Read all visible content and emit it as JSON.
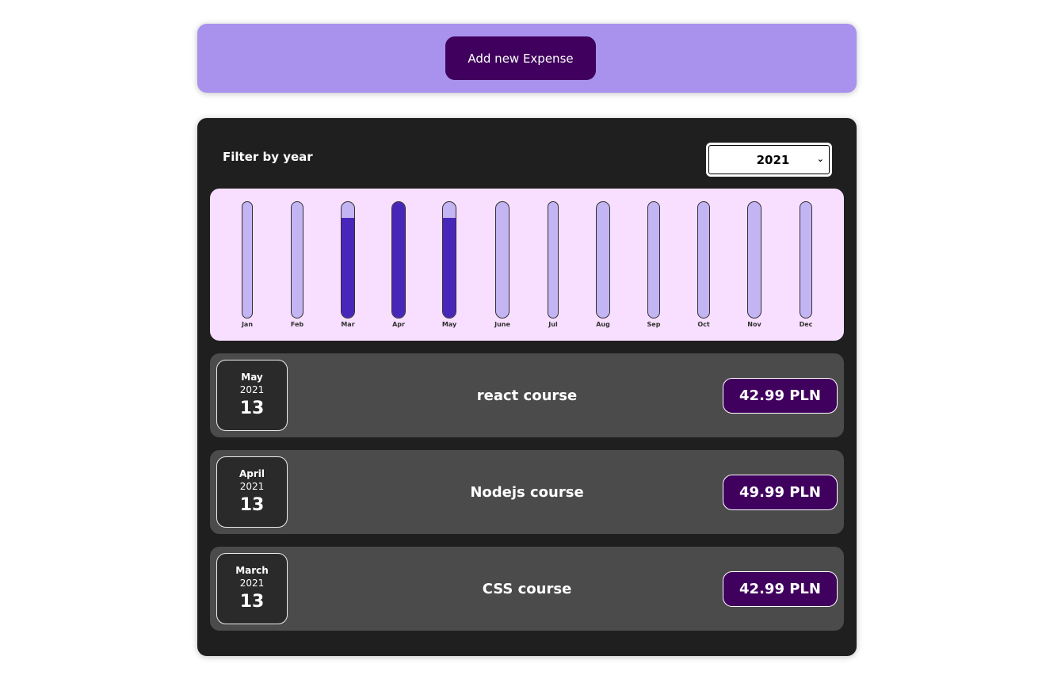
{
  "new_expense": {
    "button_label": "Add new Expense"
  },
  "filter": {
    "label": "Filter by year",
    "selected_year": "2021"
  },
  "chart_data": {
    "type": "bar",
    "categories": [
      "Jan",
      "Feb",
      "Mar",
      "Apr",
      "May",
      "June",
      "Jul",
      "Aug",
      "Sep",
      "Oct",
      "Nov",
      "Dec"
    ],
    "values": [
      0,
      0,
      42.99,
      49.99,
      42.99,
      0,
      0,
      0,
      0,
      0,
      0,
      0
    ],
    "ylim": [
      0,
      49.99
    ],
    "colors": {
      "track": "#c3b4f3",
      "fill": "#4826b9",
      "background": "#f8dfff"
    }
  },
  "expenses": [
    {
      "month": "May",
      "year": "2021",
      "day": "13",
      "title": "react course",
      "amount": "42.99 PLN"
    },
    {
      "month": "April",
      "year": "2021",
      "day": "13",
      "title": "Nodejs course",
      "amount": "49.99 PLN"
    },
    {
      "month": "March",
      "year": "2021",
      "day": "13",
      "title": "CSS course",
      "amount": "42.99 PLN"
    }
  ],
  "colors": {
    "form_bg": "#a892ee",
    "button_bg": "#40005d",
    "panel_bg": "#1f1f1f",
    "item_bg": "#4b4b4b"
  }
}
